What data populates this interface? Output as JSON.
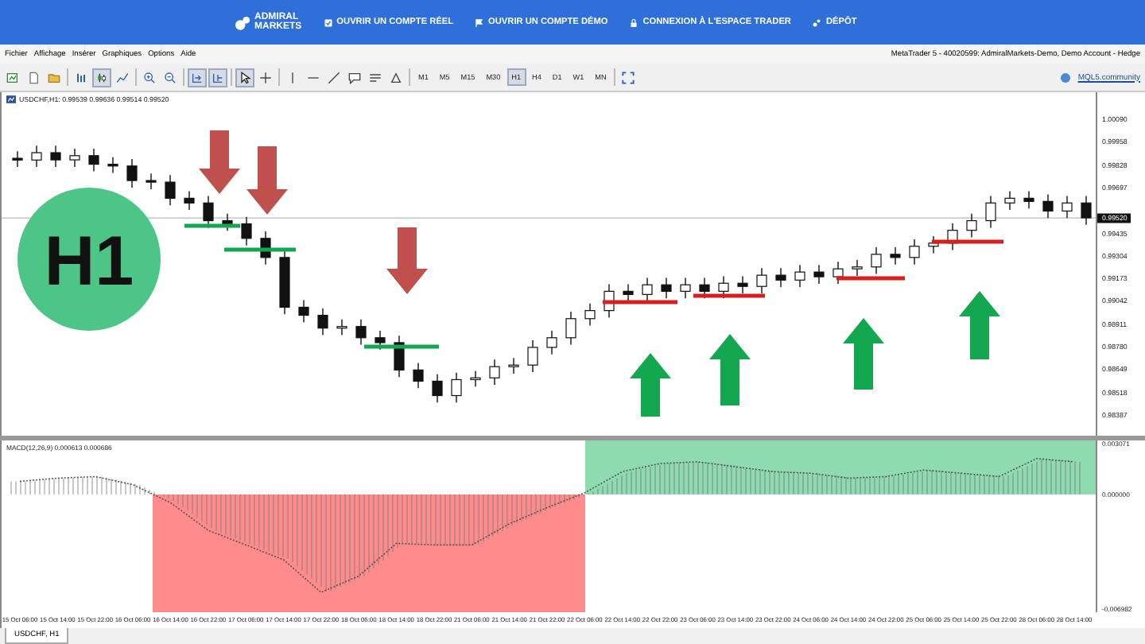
{
  "banner": {
    "logo": [
      "ADMIRAL",
      "MARKETS"
    ],
    "links": [
      {
        "kind": "check",
        "label": "OUVRIR UN COMPTE RÉEL"
      },
      {
        "kind": "flag",
        "label": "OUVRIR UN COMPTE DÉMO"
      },
      {
        "kind": "lock",
        "label": "CONNEXION À L'ESPACE TRADER"
      },
      {
        "kind": "wallet",
        "label": "DÉPÔT"
      }
    ]
  },
  "menu": [
    "Fichier",
    "Affichage",
    "Insérer",
    "Graphiques",
    "Options",
    "Aide"
  ],
  "window": {
    "title": "MetaTrader 5 - 40020599: AdmiralMarkets-Demo, Demo Account - Hedge"
  },
  "timeframes": [
    {
      "label": "M1",
      "selected": false
    },
    {
      "label": "M5",
      "selected": false
    },
    {
      "label": "M15",
      "selected": false
    },
    {
      "label": "M30",
      "selected": false
    },
    {
      "label": "H1",
      "selected": true
    },
    {
      "label": "H4",
      "selected": false
    },
    {
      "label": "D1",
      "selected": false
    },
    {
      "label": "W1",
      "selected": false
    },
    {
      "label": "MN",
      "selected": false
    }
  ],
  "community_link": "MQL5.community",
  "chart": {
    "header": "USDCHF,H1: 0.99539 0.99636 0.99514 0.99520",
    "badge": "H1",
    "levels": [
      {
        "kind": "support"
      },
      {
        "kind": "support"
      },
      {
        "kind": "support"
      },
      {
        "kind": "resistance"
      },
      {
        "kind": "resistance"
      },
      {
        "kind": "resistance"
      },
      {
        "kind": "resistance"
      }
    ],
    "signals": [
      {
        "kind": "down"
      },
      {
        "kind": "down"
      },
      {
        "kind": "down"
      },
      {
        "kind": "up"
      },
      {
        "kind": "up"
      },
      {
        "kind": "up"
      },
      {
        "kind": "up"
      }
    ],
    "chart_data": {
      "type": "candlestick",
      "ylim": [
        0.98277,
        1.00237
      ],
      "yticks": [
        {
          "value": 1.0009,
          "label": "1.00090"
        },
        {
          "value": 0.99958,
          "label": "0.99958"
        },
        {
          "value": 0.99828,
          "label": "0.99828"
        },
        {
          "value": 0.99697,
          "label": "0.99697"
        },
        {
          "value": 0.99435,
          "label": "0.99435"
        },
        {
          "value": 0.99304,
          "label": "0.99304"
        },
        {
          "value": 0.99173,
          "label": "0.99173"
        },
        {
          "value": 0.99042,
          "label": "0.99042"
        },
        {
          "value": 0.98911,
          "label": "0.98911"
        },
        {
          "value": 0.9878,
          "label": "0.98780"
        },
        {
          "value": 0.98649,
          "label": "0.98649"
        },
        {
          "value": 0.98518,
          "label": "0.98518"
        },
        {
          "value": 0.98387,
          "label": "0.98387"
        }
      ],
      "ref_lines": [
        {
          "axis": "y",
          "value": 0.9952,
          "label": "0.99520"
        }
      ],
      "categories": [
        null,
        null,
        null,
        null,
        null,
        null,
        null,
        null,
        null,
        null,
        null,
        null,
        null,
        null,
        null,
        null,
        null,
        null,
        null,
        null,
        null,
        null,
        null,
        null,
        null,
        null,
        null,
        null,
        null,
        null,
        null,
        null,
        null,
        null,
        null,
        null,
        null,
        null,
        null,
        null,
        null,
        null,
        null,
        null,
        null,
        null,
        null,
        null,
        null,
        null,
        null,
        null,
        null,
        null,
        null,
        null,
        null
      ],
      "ohlc": [
        [
          0.9986,
          0.999,
          0.9981,
          0.9985
        ],
        [
          0.9985,
          0.99932,
          0.9981,
          0.99892
        ],
        [
          0.99892,
          0.99932,
          0.99811,
          0.99851
        ],
        [
          0.99851,
          0.99915,
          0.99811,
          0.99875
        ],
        [
          0.99875,
          0.99915,
          0.99786,
          0.99826
        ],
        [
          0.99826,
          0.99866,
          0.99776,
          0.99816
        ],
        [
          0.99816,
          0.99856,
          0.99693,
          0.99733
        ],
        [
          0.99733,
          0.99773,
          0.99684,
          0.99724
        ],
        [
          0.99724,
          0.99764,
          0.99592,
          0.99632
        ],
        [
          0.99632,
          0.99672,
          0.99565,
          0.99605
        ],
        [
          0.99605,
          0.99645,
          0.99464,
          0.99504
        ],
        [
          0.99504,
          0.99544,
          0.99446,
          0.99486
        ],
        [
          0.99486,
          0.99526,
          0.99363,
          0.99403
        ],
        [
          0.99403,
          0.99443,
          0.99254,
          0.99294
        ],
        [
          0.99294,
          0.99334,
          0.9897,
          0.9901
        ],
        [
          0.9901,
          0.9905,
          0.98924,
          0.98964
        ],
        [
          0.98964,
          0.99004,
          0.98851,
          0.98891
        ],
        [
          0.98891,
          0.9894,
          0.98851,
          0.989
        ],
        [
          0.989,
          0.9894,
          0.98796,
          0.98836
        ],
        [
          0.98836,
          0.98876,
          0.98768,
          0.98808
        ],
        [
          0.98808,
          0.98848,
          0.98612,
          0.98652
        ],
        [
          0.98652,
          0.98692,
          0.98548,
          0.98588
        ],
        [
          0.98588,
          0.98628,
          0.98466,
          0.98506
        ],
        [
          0.98506,
          0.98637,
          0.98466,
          0.98597
        ],
        [
          0.98597,
          0.98647,
          0.98557,
          0.98607
        ],
        [
          0.98607,
          0.98711,
          0.98567,
          0.98671
        ],
        [
          0.98671,
          0.9872,
          0.98631,
          0.9868
        ],
        [
          0.9868,
          0.98821,
          0.9864,
          0.98781
        ],
        [
          0.98781,
          0.98876,
          0.98741,
          0.98836
        ],
        [
          0.98836,
          0.98985,
          0.98796,
          0.98945
        ],
        [
          0.98945,
          0.99031,
          0.98905,
          0.98991
        ],
        [
          0.98991,
          0.99141,
          0.98951,
          0.99101
        ],
        [
          0.99101,
          0.99141,
          0.99043,
          0.99083
        ],
        [
          0.99083,
          0.99178,
          0.99043,
          0.99138
        ],
        [
          0.99138,
          0.99178,
          0.99061,
          0.99101
        ],
        [
          0.99101,
          0.99178,
          0.99061,
          0.99138
        ],
        [
          0.99138,
          0.99178,
          0.99061,
          0.99101
        ],
        [
          0.99101,
          0.99187,
          0.99061,
          0.99147
        ],
        [
          0.99147,
          0.99187,
          0.99089,
          0.99129
        ],
        [
          0.99129,
          0.99233,
          0.99089,
          0.99193
        ],
        [
          0.99193,
          0.99233,
          0.99125,
          0.99165
        ],
        [
          0.99165,
          0.99251,
          0.99125,
          0.99211
        ],
        [
          0.99211,
          0.99251,
          0.99144,
          0.99184
        ],
        [
          0.99184,
          0.99269,
          0.99144,
          0.99229
        ],
        [
          0.99229,
          0.9928,
          0.99189,
          0.9924
        ],
        [
          0.9924,
          0.99352,
          0.992,
          0.99312
        ],
        [
          0.99312,
          0.99352,
          0.99254,
          0.99294
        ],
        [
          0.99294,
          0.99398,
          0.99254,
          0.99358
        ],
        [
          0.99358,
          0.99416,
          0.99318,
          0.99376
        ],
        [
          0.99376,
          0.99489,
          0.99336,
          0.99449
        ],
        [
          0.99449,
          0.99544,
          0.99409,
          0.99504
        ],
        [
          0.99504,
          0.99645,
          0.99464,
          0.99605
        ],
        [
          0.99605,
          0.99672,
          0.99565,
          0.99632
        ],
        [
          0.99632,
          0.99672,
          0.99574,
          0.99614
        ],
        [
          0.99614,
          0.99654,
          0.99519,
          0.99559
        ],
        [
          0.99559,
          0.99645,
          0.99519,
          0.99605
        ],
        [
          0.99605,
          0.99645,
          0.9948,
          0.9952
        ]
      ]
    }
  },
  "macd": {
    "header": "MACD(12,26,9) 0.000613 0.000686",
    "chart_data": {
      "type": "line",
      "ylim": [
        -0.00722,
        0.00331
      ],
      "yticks": [
        {
          "value": 0.003071,
          "label": "0.003071"
        },
        {
          "value": 0,
          "label": "0.000000"
        },
        {
          "value": -0.006982,
          "label": "-0.006982"
        }
      ],
      "categories": [
        "15 Oct 06:00",
        "15 Oct 14:00",
        "15 Oct 22:00",
        "16 Oct 06:00",
        "16 Oct 14:00",
        "16 Oct 22:00",
        "17 Oct 06:00",
        "17 Oct 14:00",
        "17 Oct 22:00",
        "18 Oct 06:00",
        "18 Oct 14:00",
        "18 Oct 22:00",
        "21 Oct 06:00",
        "21 Oct 14:00",
        "21 Oct 22:00",
        "22 Oct 06:00",
        "22 Oct 14:00",
        "22 Oct 22:00",
        "23 Oct 06:00",
        "23 Oct 14:00",
        "23 Oct 22:00",
        "24 Oct 06:00",
        "24 Oct 14:00",
        "24 Oct 22:00",
        "25 Oct 06:00",
        "25 Oct 14:00",
        "25 Oct 22:00",
        "28 Oct 06:00",
        "28 Oct 14:00"
      ],
      "series": [
        {
          "color": "#555555",
          "line_style": "dotted",
          "values": [
            0.0008,
            0.001,
            0.0011,
            0.0006,
            -0.0005,
            -0.0022,
            -0.0031,
            -0.004,
            -0.006,
            -0.005,
            -0.003,
            -0.0031,
            -0.0031,
            -0.0018,
            -0.0008,
            0.0001,
            0.0014,
            0.0019,
            0.002,
            0.0017,
            0.0014,
            0.0013,
            0.001,
            0.0011,
            0.0015,
            0.0013,
            0.0011,
            0.0022,
            0.002
          ]
        }
      ]
    }
  },
  "tabs": [
    {
      "label": "USDCHF, H1",
      "selected": true
    }
  ]
}
